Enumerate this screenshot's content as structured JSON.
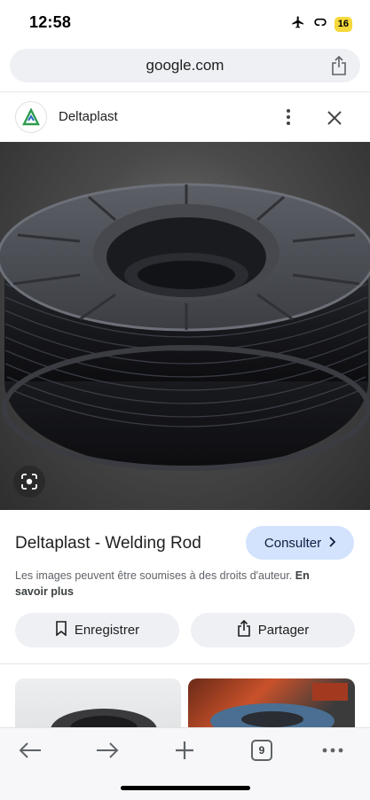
{
  "status": {
    "time": "12:58",
    "battery": "16"
  },
  "browser": {
    "url": "google.com",
    "tab_count": "9"
  },
  "site": {
    "name": "Deltaplast"
  },
  "result": {
    "title": "Deltaplast - Welding Rod",
    "visit_label": "Consulter",
    "copyright_text": "Les images peuvent être soumises à des droits d'auteur.",
    "learn_more": "En savoir plus",
    "save_label": "Enregistrer",
    "share_label": "Partager"
  },
  "icons": [
    "airplane-icon",
    "link-icon",
    "battery-icon",
    "share-icon",
    "more-vert-icon",
    "close-icon",
    "lens-icon",
    "bookmark-icon",
    "chevron-right-icon",
    "back-icon",
    "forward-icon",
    "new-tab-icon",
    "tabs-icon",
    "more-horiz-icon"
  ],
  "colors": {
    "visit_button": "#d3e3fd",
    "battery": "#f5d83b",
    "pill_background": "#eef0f4"
  }
}
